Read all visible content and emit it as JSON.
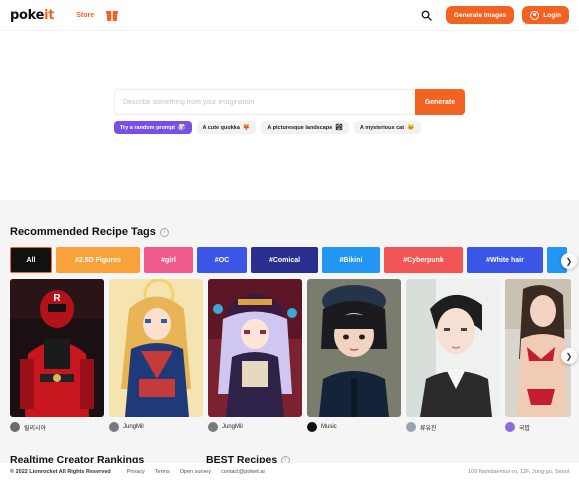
{
  "header": {
    "logo_main": "poke",
    "logo_accent": "it",
    "store_label": "Store",
    "generate_images_label": "Generate Images",
    "login_label": "Login"
  },
  "prompt": {
    "placeholder": "Describe something from your imagination",
    "generate_label": "Generate",
    "chips": [
      {
        "label": "Try a random prompt",
        "emoji": "🎲"
      },
      {
        "label": "A cute quokka",
        "emoji": "🦊"
      },
      {
        "label": "A picturesque landscape",
        "emoji": "🏞"
      },
      {
        "label": "A mysterious cat",
        "emoji": "🐱"
      }
    ]
  },
  "recipes": {
    "title": "Recommended Recipe Tags",
    "tags": [
      {
        "label": "All",
        "color": "#111111"
      },
      {
        "label": "#2.5D Figures",
        "color": "#f9a23a"
      },
      {
        "label": "#girl",
        "color": "#ef5a8a"
      },
      {
        "label": "#OC",
        "color": "#3b56e6"
      },
      {
        "label": "#Comical",
        "color": "#2a2f8f"
      },
      {
        "label": "#Bikini",
        "color": "#2196f3"
      },
      {
        "label": "#Cyberpunk",
        "color": "#f25555"
      },
      {
        "label": "#White hair",
        "color": "#3b56e6"
      }
    ],
    "creators": [
      {
        "name": "릴리시아",
        "avatar_color": "#6b6b6b"
      },
      {
        "name": "JungMil",
        "avatar_color": "#7a7a7a"
      },
      {
        "name": "JungMil",
        "avatar_color": "#7a7a7a"
      },
      {
        "name": "Music",
        "avatar_color": "#111111"
      },
      {
        "name": "류유진",
        "avatar_color": "#9aa4b1"
      },
      {
        "name": "국밥",
        "avatar_color": "#8a6dd8"
      }
    ]
  },
  "sections": {
    "rankings_title": "Realtime Creator Rankings",
    "best_title": "BEST Recipes"
  },
  "footer": {
    "copyright": "© 2022 Lionrocket All Rights Reserved",
    "privacy": "Privacy",
    "terms": "Terms",
    "survey": "Open survey",
    "contact": "contact@pokeit.ai",
    "address": "109 Namdaemun-ro, 12F, Jung-gu, Seoul"
  },
  "colors": {
    "brand": "#f26322",
    "random_chip": "#7a4fe8"
  }
}
